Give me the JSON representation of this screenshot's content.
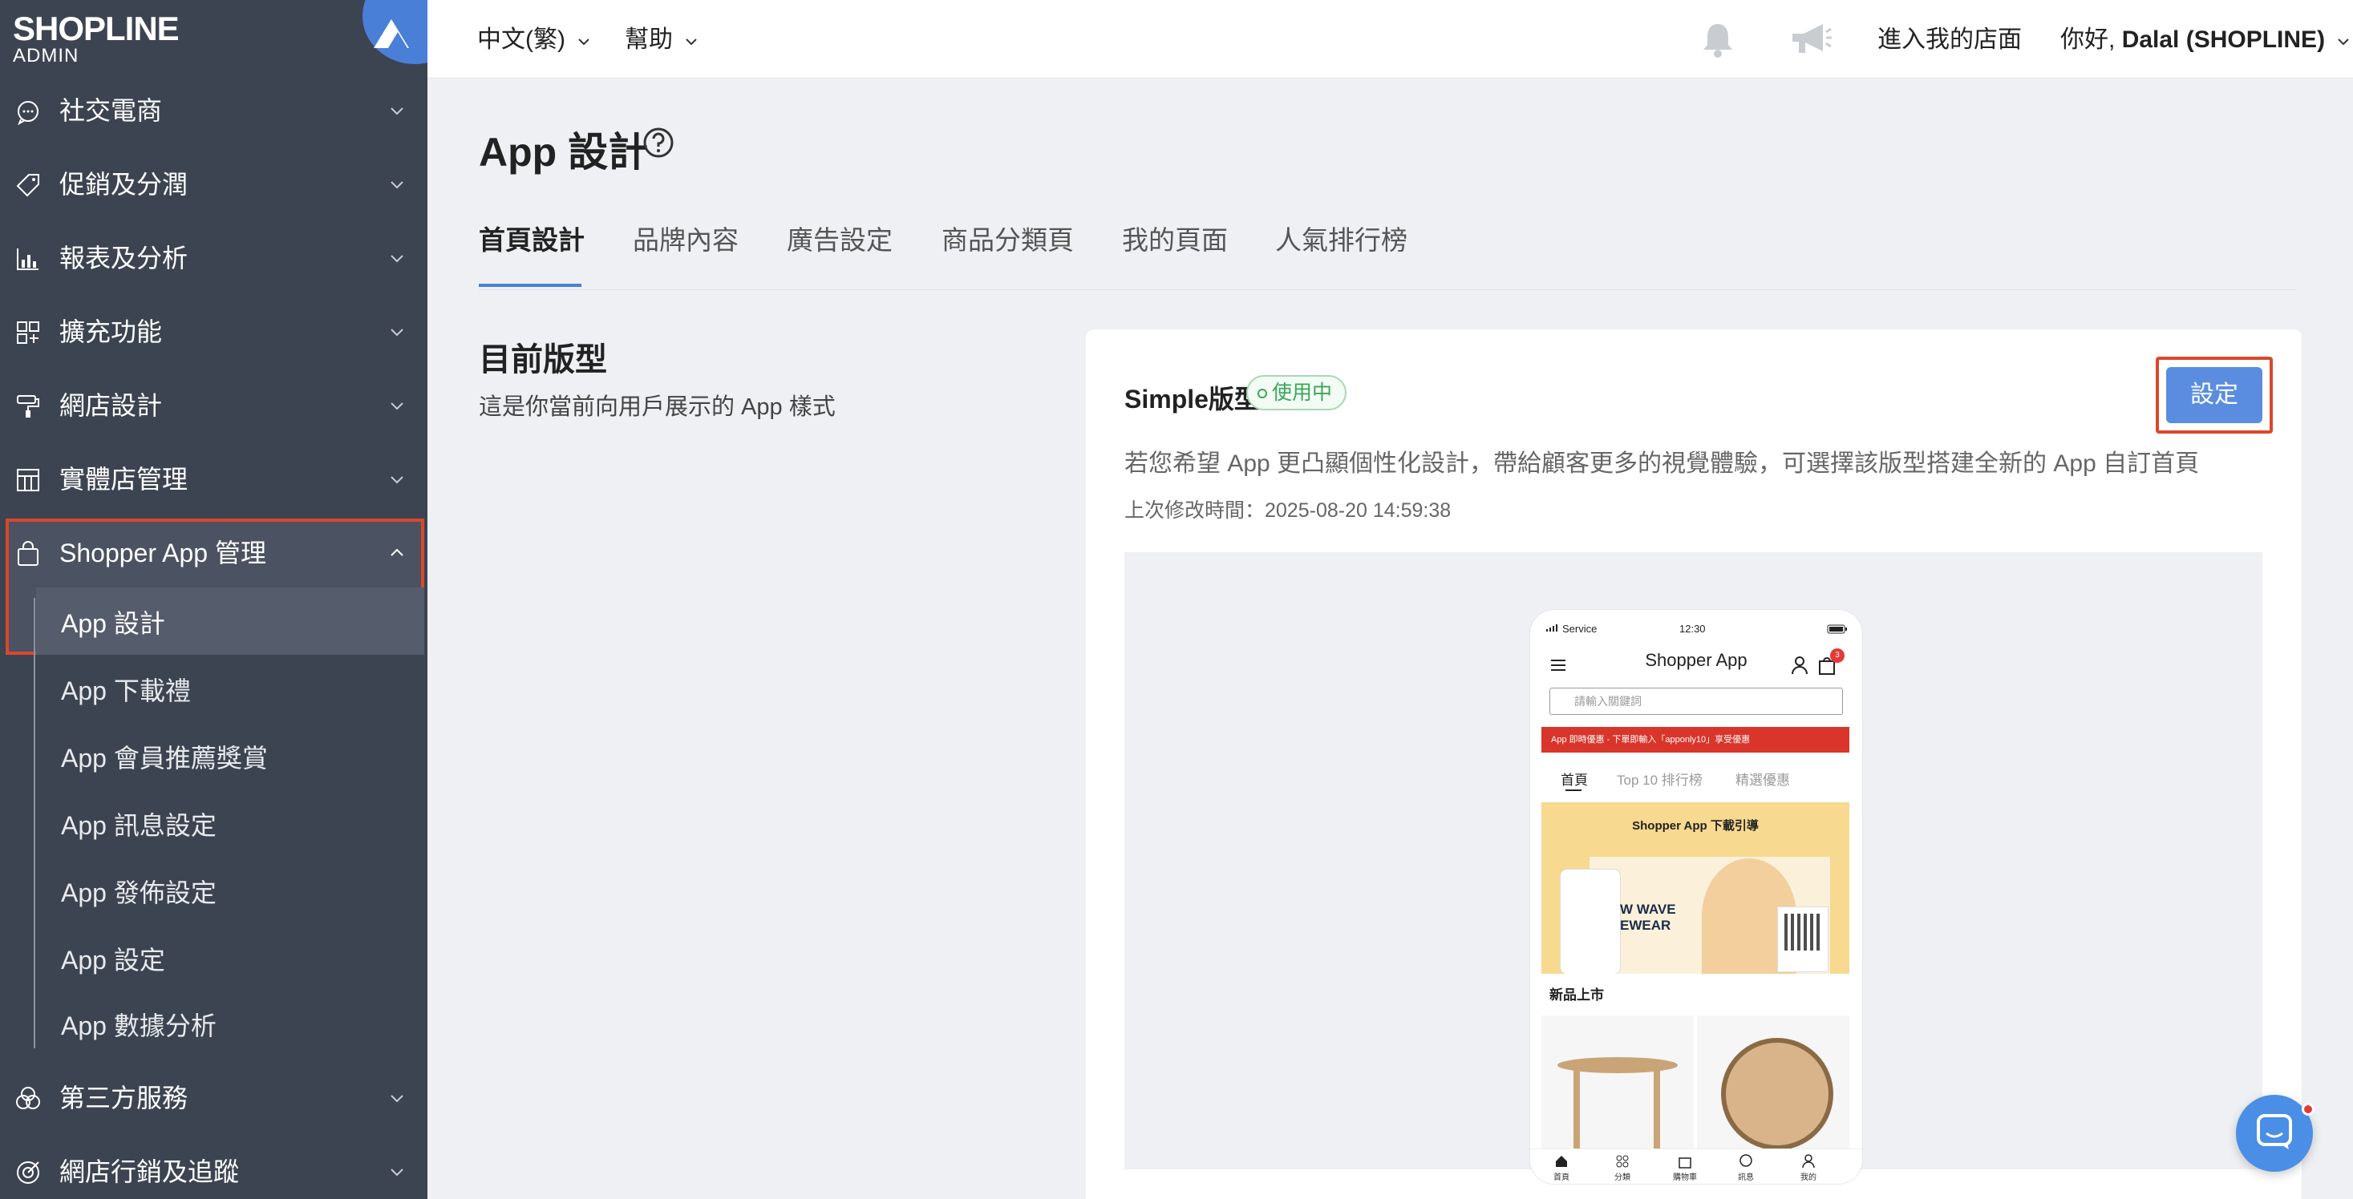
{
  "brand": {
    "name": "SHOPLINE",
    "sub": "ADMIN"
  },
  "sidebar": {
    "items": [
      {
        "label": "社交電商",
        "icon": "chat-bubble-icon"
      },
      {
        "label": "促銷及分潤",
        "icon": "tag-icon"
      },
      {
        "label": "報表及分析",
        "icon": "chart-icon"
      },
      {
        "label": "擴充功能",
        "icon": "apps-grid-icon"
      },
      {
        "label": "網店設計",
        "icon": "paint-roller-icon"
      },
      {
        "label": "實體店管理",
        "icon": "store-icon"
      },
      {
        "label": "Shopper App 管理",
        "icon": "shopping-bag-icon"
      },
      {
        "label": "第三方服務",
        "icon": "circles-icon"
      },
      {
        "label": "網店行銷及追蹤",
        "icon": "target-icon"
      }
    ],
    "subitems": [
      "App 設計",
      "App 下載禮",
      "App 會員推薦獎賞",
      "App 訊息設定",
      "App 發佈設定",
      "App 設定",
      "App 數據分析"
    ]
  },
  "topbar": {
    "language": "中文(繁)",
    "help": "幫助",
    "store_link": "進入我的店面",
    "greeting": "你好,",
    "user": "Dalal (SHOPLINE)"
  },
  "page": {
    "title": "App 設計",
    "tabs": [
      "首頁設計",
      "品牌內容",
      "廣告設定",
      "商品分類頁",
      "我的頁面",
      "人氣排行榜"
    ],
    "section_title": "目前版型",
    "section_desc": "這是你當前向用戶展示的 App 樣式"
  },
  "card": {
    "title": "Simple版型",
    "badge": "使用中",
    "button": "設定",
    "desc": "若您希望 App 更凸顯個性化設計，帶給顧客更多的視覺體驗，可選擇該版型搭建全新的 App 自訂首頁",
    "modified": "上次修改時間：2025-08-20 14:59:38"
  },
  "phone": {
    "carrier": "Service",
    "time": "12:30",
    "title": "Shopper App",
    "cart_count": "3",
    "search_placeholder": "請輸入關鍵詞",
    "banner": "App 即時優惠 - 下單即輸入「apponly10」享受優惠",
    "tabs": [
      "首頁",
      "Top 10 排行榜",
      "精選優惠"
    ],
    "hero_title": "Shopper App 下載引導",
    "hero_text": "W WAVE EWEAR",
    "new_title": "新品上市",
    "nav": [
      "首頁",
      "分類",
      "購物車",
      "訊息",
      "我的"
    ]
  },
  "colors": {
    "accent": "#4a7fd8",
    "sidebar": "#3d4451",
    "highlight": "#d9482b",
    "success": "#3aa65a"
  }
}
